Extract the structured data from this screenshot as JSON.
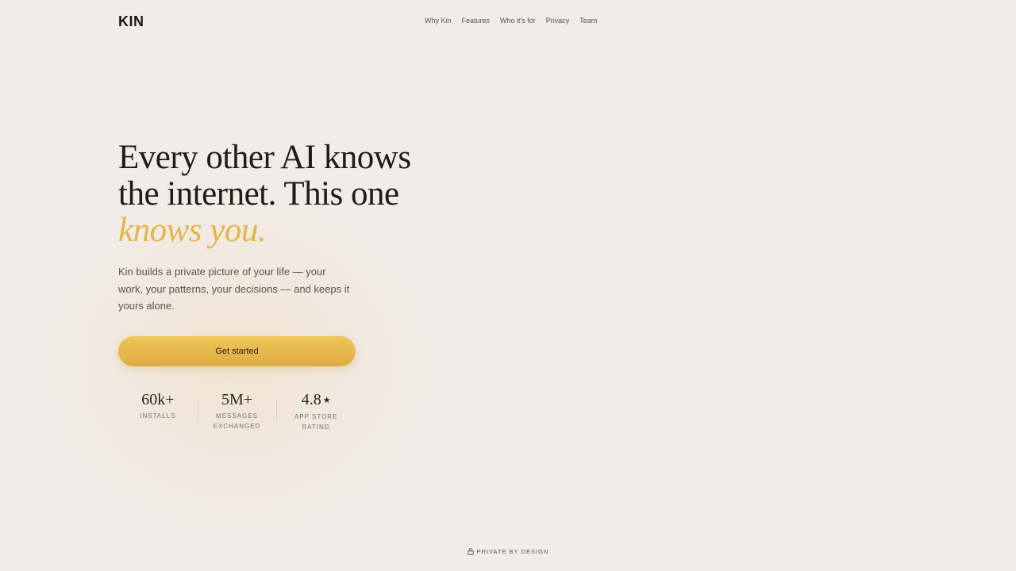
{
  "brand": {
    "logo": "KIN"
  },
  "nav": {
    "items": [
      {
        "label": "Why Kin"
      },
      {
        "label": "Features"
      },
      {
        "label": "Who it's for"
      },
      {
        "label": "Privacy"
      },
      {
        "label": "Team"
      }
    ]
  },
  "hero": {
    "headline_line1": "Every other AI knows",
    "headline_line2": "the internet. This one",
    "headline_accent": "knows you.",
    "subtitle": "Kin builds a private picture of your life — your work, your patterns, your decisions — and keeps it yours alone.",
    "cta_label": "Get started"
  },
  "stats": [
    {
      "value": "60k+",
      "label_line1": "INSTALLS",
      "label_line2": ""
    },
    {
      "value": "5M+",
      "label_line1": "MESSAGES",
      "label_line2": "EXCHANGED"
    },
    {
      "value": "4.8",
      "star": "★",
      "label_line1": "APP STORE",
      "label_line2": "RATING"
    }
  ],
  "footer": {
    "badge": "PRIVATE BY DESIGN",
    "badge_icon": "lock-icon"
  },
  "colors": {
    "background": "#f2ece6",
    "accent": "#e3b648",
    "cta": "#e8bb4f"
  }
}
